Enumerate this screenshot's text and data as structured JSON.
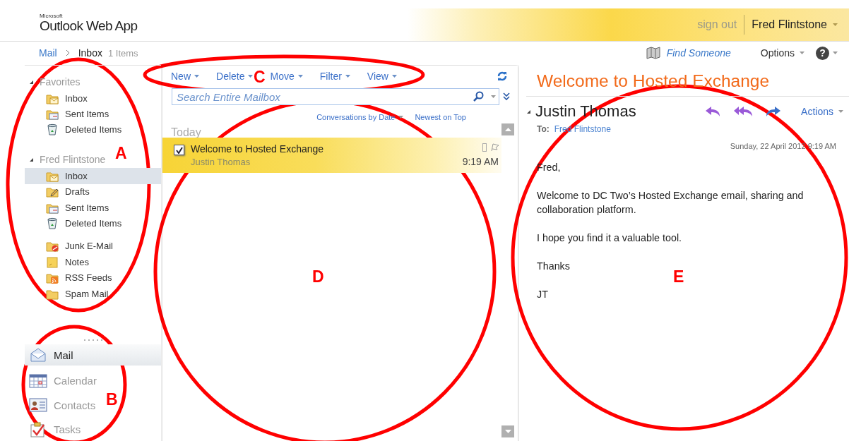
{
  "header": {
    "brand": "Microsoft",
    "app_name": "Outlook Web App",
    "sign_out": "sign out",
    "user_name": "Fred Flintstone"
  },
  "breadcrumb": {
    "module": "Mail",
    "folder": "Inbox",
    "count": "1 Items"
  },
  "top_links": {
    "find_someone": "Find Someone",
    "options": "Options",
    "help": "?"
  },
  "folder_groups": [
    {
      "name": "Favorites",
      "expanded": true,
      "folders": [
        {
          "name": "Inbox",
          "kind": "inbox",
          "selected": false,
          "separated": false
        },
        {
          "name": "Sent Items",
          "kind": "sent",
          "selected": false,
          "separated": false
        },
        {
          "name": "Deleted Items",
          "kind": "deleted",
          "selected": false,
          "separated": false
        }
      ]
    },
    {
      "name": "Fred Flintstone",
      "expanded": true,
      "folders": [
        {
          "name": "Inbox",
          "kind": "inbox",
          "selected": true,
          "separated": false
        },
        {
          "name": "Drafts",
          "kind": "drafts",
          "selected": false,
          "separated": false
        },
        {
          "name": "Sent Items",
          "kind": "sent",
          "selected": false,
          "separated": false
        },
        {
          "name": "Deleted Items",
          "kind": "deleted",
          "selected": false,
          "separated": false
        },
        {
          "name": "Junk E-Mail",
          "kind": "junk",
          "selected": false,
          "separated": true
        },
        {
          "name": "Notes",
          "kind": "notes",
          "selected": false,
          "separated": false
        },
        {
          "name": "RSS Feeds",
          "kind": "rss",
          "selected": false,
          "separated": false
        },
        {
          "name": "Spam Mail",
          "kind": "folder",
          "selected": false,
          "separated": false
        }
      ]
    }
  ],
  "modules": [
    {
      "label": "Mail",
      "kind": "mail",
      "selected": true
    },
    {
      "label": "Calendar",
      "kind": "calendar",
      "selected": false
    },
    {
      "label": "Contacts",
      "kind": "contacts",
      "selected": false
    },
    {
      "label": "Tasks",
      "kind": "tasks",
      "selected": false
    }
  ],
  "toolbar": [
    {
      "label": "New"
    },
    {
      "label": "Delete"
    },
    {
      "label": "Move"
    },
    {
      "label": "Filter"
    },
    {
      "label": "View"
    }
  ],
  "search": {
    "placeholder": "Search Entire Mailbox"
  },
  "sort": {
    "arrange_by": "Conversations by Date",
    "order": "Newest on Top"
  },
  "message_list": {
    "group": "Today",
    "messages": [
      {
        "subject": "Welcome to Hosted Exchange",
        "sender": "Justin Thomas",
        "time": "9:19 AM",
        "checked": true,
        "selected": true
      }
    ]
  },
  "reading_pane": {
    "subject": "Welcome to Hosted Exchange",
    "sender": "Justin Thomas",
    "to_label": "To:",
    "to": "Fred Flintstone",
    "actions": "Actions",
    "date": "Sunday, 22 April 2012 9:19 AM",
    "body": [
      "Fred,",
      "Welcome to DC Two’s Hosted Exchange email, sharing and collaboration platform.",
      "I hope you find it a valuable tool.",
      "Thanks",
      "JT"
    ]
  },
  "annotations": [
    {
      "label": "A"
    },
    {
      "label": "B"
    },
    {
      "label": "C"
    },
    {
      "label": "D"
    },
    {
      "label": "E"
    }
  ]
}
